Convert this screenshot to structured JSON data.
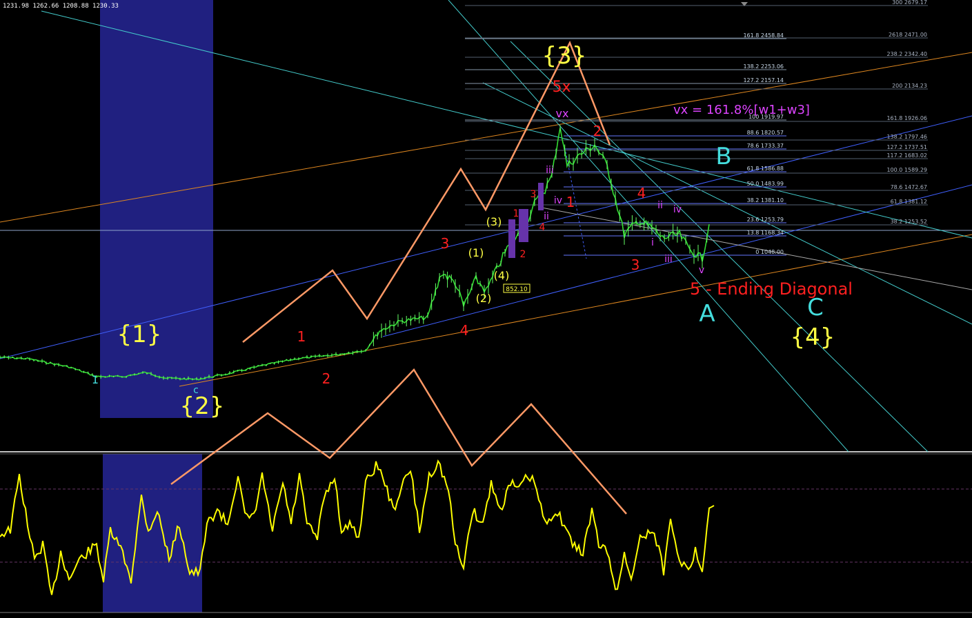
{
  "ohlc_header": "1231.98 1262.66 1208.88 1230.33",
  "colors": {
    "background": "#000000",
    "price": "#33dd33",
    "oscillator": "#ffff00",
    "impulse_arrows": "#ff9966",
    "wave_red": "#ff2020",
    "wave_yellow": "#ffff44",
    "wave_cyan": "#44dddd",
    "wave_magenta": "#dd44ff",
    "highlight_zone": "#202080",
    "fib_levels": "#8899aa"
  },
  "annotations": {
    "wave_1": "{1}",
    "wave_2": "{2}",
    "wave_3": "{3}",
    "wave_4": "{4}",
    "ending_diagonal": "5 - Ending Diagonal",
    "formula": "vx = 161.8%[w1+w3]",
    "wave_a": "A",
    "wave_b": "B",
    "wave_c": "C",
    "label_5x": "5x",
    "label_vx": "vx",
    "price_tag": "852.10",
    "sub_c": "c",
    "sub_1_cyan": "1"
  },
  "small_labels": {
    "red_1a": "1",
    "red_2a": "2",
    "red_3a": "3",
    "red_4a": "4",
    "red_1b": "1",
    "red_2b": "2",
    "red_3b": "3",
    "red_4b": "4",
    "red_1c": "1",
    "red_2c": "2",
    "red_3c": "3",
    "red_4c": "4",
    "yel_1": "(1)",
    "yel_2": "(2)",
    "yel_3": "(3)",
    "yel_4": "(4)",
    "mag_i": "i",
    "mag_ii": "ii",
    "mag_iii": "iii",
    "mag_iv": "iv",
    "mag_v": "v",
    "mag_ii_b": "ii",
    "mag_iii_b": "iii",
    "mag_iv_b": "iv",
    "mag_i_b": "i"
  },
  "fib_left": [
    {
      "label": "161.8 2458.84"
    },
    {
      "label": "138.2 2253.06"
    },
    {
      "label": "127.2 2157.14"
    },
    {
      "label": "100 1919.97"
    },
    {
      "label": "88.6 1820.57"
    },
    {
      "label": "78.6 1733.37"
    },
    {
      "label": "61.8 1586.88"
    },
    {
      "label": "50.0 1483.99"
    },
    {
      "label": "38.2 1381.10"
    },
    {
      "label": "23.6 1253.79"
    },
    {
      "label": "13.8 1168.34"
    },
    {
      "label": "0 1048.00"
    }
  ],
  "fib_right": [
    {
      "label": "300 2679.17"
    },
    {
      "label": "2618 2471.00"
    },
    {
      "label": "238.2 2342.40"
    },
    {
      "label": "200 2134.23"
    },
    {
      "label": "161.8 1926.06"
    },
    {
      "label": "138.2 1797.46"
    },
    {
      "label": "127.2 1737.51"
    },
    {
      "label": "117.2 1683.02"
    },
    {
      "label": "100.0 1589.29"
    },
    {
      "label": "78.6 1472.67"
    },
    {
      "label": "61.8 1381.12"
    },
    {
      "label": "38.2 1253.52"
    }
  ],
  "chart_data": {
    "type": "line",
    "series": [
      {
        "values": [
          1.0,
          1.02,
          1.05,
          1.0,
          0.96,
          0.98,
          1.02,
          1.08,
          1.2,
          1.45,
          1.9,
          2.2,
          2.1,
          2.4,
          2.8,
          3.2,
          3.0,
          4.4,
          3.9,
          3.4,
          2.7,
          2.2,
          2.0,
          1.8,
          2.1
        ]
      },
      {
        "values": [
          0.3,
          0.1,
          0.4,
          0.0,
          0.5,
          0.2,
          0.8,
          0.6,
          0.9,
          0.7,
          0.85,
          0.3,
          0.8,
          0.5,
          0.9,
          0.6,
          0.8,
          0.4,
          0.7,
          0.2,
          0.5,
          0.3,
          0.6,
          0.4,
          0.8
        ]
      }
    ]
  }
}
